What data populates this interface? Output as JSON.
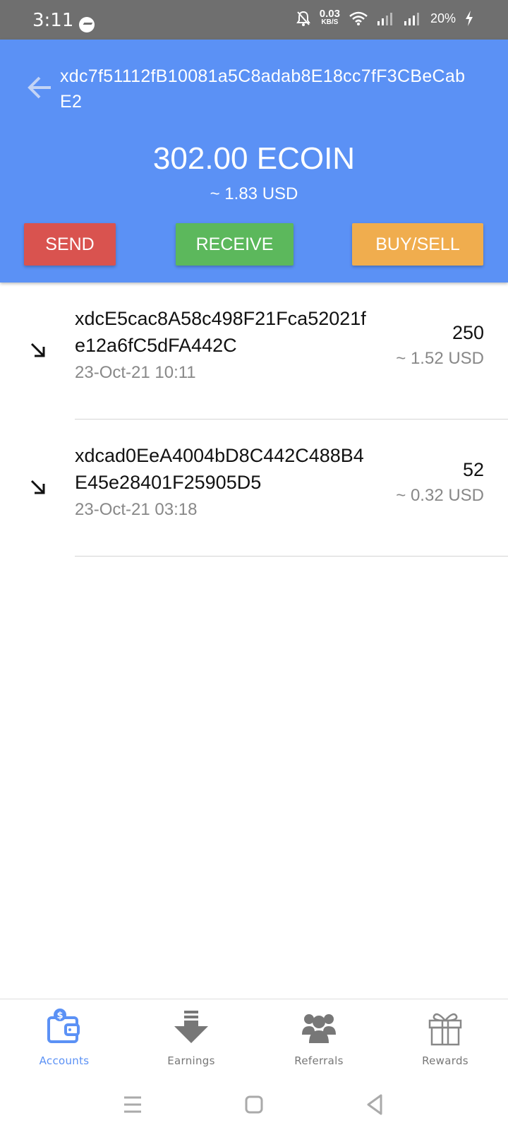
{
  "status_bar": {
    "time": "3:11",
    "net_speed_value": "0.03",
    "net_speed_unit": "KB/S",
    "battery": "20%",
    "icons": [
      "messenger-icon",
      "bell-muted-icon",
      "wifi-icon",
      "signal-icon",
      "signal-icon",
      "charging-icon"
    ]
  },
  "header": {
    "address": "xdc7f51112fB10081a5C8adab8E18cc7fF3CBeCabE2",
    "balance": "302.00 ECOIN",
    "balance_usd": "~ 1.83 USD",
    "buttons": {
      "send": "SEND",
      "receive": "RECEIVE",
      "buy_sell": "BUY/SELL"
    },
    "colors": {
      "background": "#5b91f5",
      "send": "#d9534f",
      "receive": "#5cb85c",
      "buy_sell": "#f0ad4e"
    }
  },
  "transactions": [
    {
      "direction_icon": "incoming-arrow-icon",
      "address": "xdcE5cac8A58c498F21Fca52021fe12a6fC5dFA442C",
      "date": "23-Oct-21 10:11",
      "amount": "250",
      "usd": "~ 1.52 USD"
    },
    {
      "direction_icon": "incoming-arrow-icon",
      "address": "xdcad0EeA4004bD8C442C488B4E45e28401F25905D5",
      "date": "23-Oct-21 03:18",
      "amount": "52",
      "usd": "~ 0.32 USD"
    }
  ],
  "bottom_nav": {
    "active": "Accounts",
    "active_color": "#5b91f5",
    "items": [
      {
        "label": "Accounts",
        "icon": "wallet-icon"
      },
      {
        "label": "Earnings",
        "icon": "download-icon"
      },
      {
        "label": "Referrals",
        "icon": "group-icon"
      },
      {
        "label": "Rewards",
        "icon": "gift-icon"
      }
    ]
  },
  "system_nav": {
    "icons": [
      "menu-icon",
      "home-icon",
      "back-icon"
    ]
  }
}
